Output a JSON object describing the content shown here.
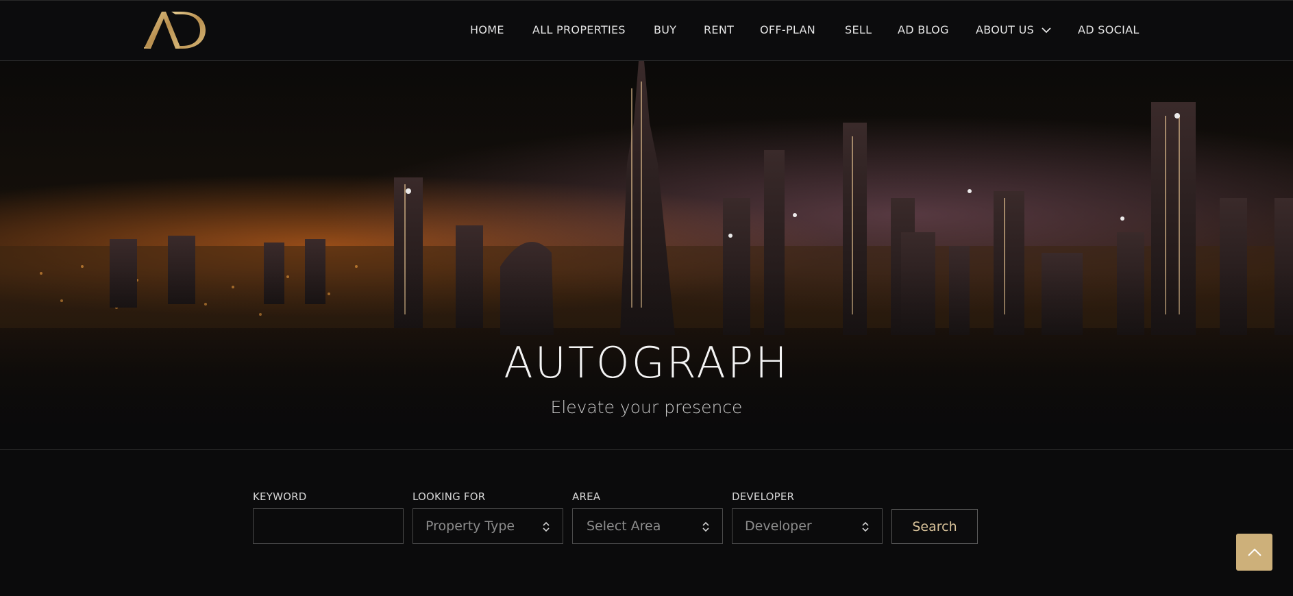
{
  "brand": {
    "logo_text": "AD",
    "logo_color": "#c9a86a"
  },
  "nav": {
    "items": [
      "HOME",
      "ALL PROPERTIES",
      "BUY",
      "RENT",
      "OFF-PLAN",
      "SELL",
      "AD BLOG",
      "ABOUT US",
      "AD SOCIAL"
    ]
  },
  "hero": {
    "title": "AUTOGRAPH",
    "subtitle": "Elevate your presence"
  },
  "search": {
    "keyword": {
      "label": "KEYWORD",
      "value": ""
    },
    "looking_for": {
      "label": "LOOKING FOR",
      "selected": "Property Type"
    },
    "area": {
      "label": "AREA",
      "selected": "Select Area"
    },
    "developer": {
      "label": "DEVELOPER",
      "selected": "Developer"
    },
    "button": "Search"
  },
  "colors": {
    "accent": "#cdb07a",
    "background": "#0b0b0c"
  },
  "icons": {
    "scroll_top": "chevron-up-icon",
    "dropdown": "chevron-down-icon",
    "select": "updown-icon"
  }
}
